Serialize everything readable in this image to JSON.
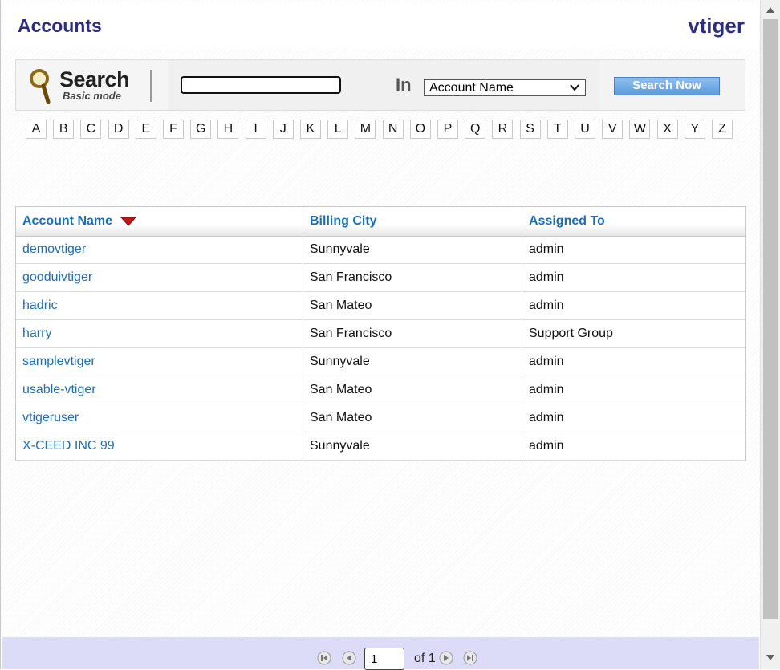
{
  "header": {
    "title": "Accounts",
    "brand": "vtiger"
  },
  "search": {
    "logo_word": "Search",
    "logo_subtitle": "Basic mode",
    "input_value": "",
    "in_label": "In",
    "field_select": "Account Name",
    "button_label": "Search Now"
  },
  "alphabet": [
    "A",
    "B",
    "C",
    "D",
    "E",
    "F",
    "G",
    "H",
    "I",
    "J",
    "K",
    "L",
    "M",
    "N",
    "O",
    "P",
    "Q",
    "R",
    "S",
    "T",
    "U",
    "V",
    "W",
    "X",
    "Y",
    "Z"
  ],
  "table": {
    "columns": [
      "Account Name",
      "Billing City",
      "Assigned To"
    ],
    "sort_column": "Account Name",
    "sort_direction": "descending",
    "rows": [
      {
        "account": "demovtiger",
        "city": "Sunnyvale",
        "assigned": "admin"
      },
      {
        "account": "gooduivtiger",
        "city": "San Francisco",
        "assigned": "admin"
      },
      {
        "account": "hadric",
        "city": "San Mateo",
        "assigned": "admin"
      },
      {
        "account": "harry",
        "city": "San Francisco",
        "assigned": "Support Group"
      },
      {
        "account": "samplevtiger",
        "city": "Sunnyvale",
        "assigned": "admin"
      },
      {
        "account": "usable-vtiger",
        "city": "San Mateo",
        "assigned": "admin"
      },
      {
        "account": "vtigeruser",
        "city": "San Mateo",
        "assigned": "admin"
      },
      {
        "account": "X-CEED INC 99",
        "city": "Sunnyvale",
        "assigned": "admin"
      }
    ]
  },
  "pagination": {
    "current_page": "1",
    "of_text": "of 1"
  },
  "colors": {
    "title": "#2e2e80",
    "link": "#1a6fb5",
    "button": "#5b9ae0",
    "footer": "#dcdcf8",
    "sort_arrow": "#c01818"
  },
  "icons": {
    "search_logo": "magnifier-icon",
    "select_chevron": "chevron-down-icon",
    "sort": "sort-descending-icon",
    "first": "first-page-icon",
    "prev": "previous-page-icon",
    "next": "next-page-icon",
    "last": "last-page-icon"
  }
}
